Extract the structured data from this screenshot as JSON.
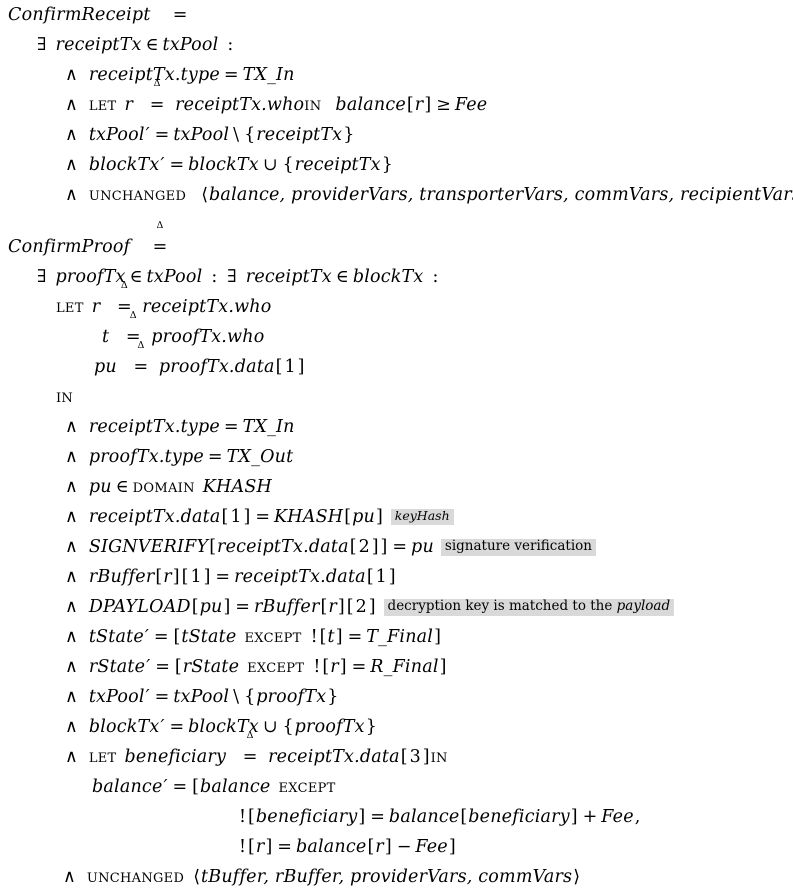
{
  "document": {
    "kind": "tla-plus-specification",
    "operators": [
      {
        "name": "ConfirmReceipt",
        "defined_as": "≜",
        "lines": [
          {
            "id": "cr-exists",
            "text": "∃ receiptTx ∈ txPool :"
          },
          {
            "id": "cr-1",
            "text": "∧ receiptTx.type = TX_In"
          },
          {
            "id": "cr-2",
            "text": "∧ LET r ≜ receiptTx.who IN balance[r] ≥ Fee"
          },
          {
            "id": "cr-3",
            "text": "∧ txPool′ = txPool \\ {receiptTx}"
          },
          {
            "id": "cr-4",
            "text": "∧ blockTx′ = blockTx ∪ {receiptTx}"
          },
          {
            "id": "cr-5",
            "text": "∧ UNCHANGED ⟨balance, providerVars, transporterVars, commVars, recipientVars⟩"
          }
        ]
      },
      {
        "name": "ConfirmProof",
        "defined_as": "≜",
        "lines": [
          {
            "id": "cp-exists",
            "text": "∃ proofTx ∈ txPool : ∃ receiptTx ∈ blockTx :"
          },
          {
            "id": "cp-let-r",
            "text": "LET r ≜ receiptTx.who"
          },
          {
            "id": "cp-let-t",
            "text": "t ≜ proofTx.who"
          },
          {
            "id": "cp-let-pu",
            "text": "pu ≜ proofTx.data[1]"
          },
          {
            "id": "cp-in",
            "text": "IN"
          },
          {
            "id": "cp-1",
            "text": "∧ receiptTx.type = TX_In"
          },
          {
            "id": "cp-2",
            "text": "∧ proofTx.type = TX_Out"
          },
          {
            "id": "cp-3",
            "text": "∧ pu ∈ DOMAIN KHASH"
          },
          {
            "id": "cp-4",
            "text": "∧ receiptTx.data[1] = KHASH[pu]"
          },
          {
            "id": "cp-5",
            "text": "∧ SIGNVERIFY[receiptTx.data[2]] = pu"
          },
          {
            "id": "cp-6",
            "text": "∧ rBuffer[r][1] = receiptTx.data[1]"
          },
          {
            "id": "cp-7",
            "text": "∧ DPAYLOAD[pu] = rBuffer[r][2]"
          },
          {
            "id": "cp-8",
            "text": "∧ tState′ = [tState EXCEPT ![t] = T_Final]"
          },
          {
            "id": "cp-9",
            "text": "∧ rState′ = [rState EXCEPT ![r] = R_Final]"
          },
          {
            "id": "cp-10",
            "text": "∧ txPool′ = txPool \\ {proofTx}"
          },
          {
            "id": "cp-11",
            "text": "∧ blockTx′ = blockTx ∪ {proofTx}"
          },
          {
            "id": "cp-12",
            "text": "∧ LET beneficiary ≜ receiptTx.data[3] IN"
          },
          {
            "id": "cp-13",
            "text": "balance′ = [balance EXCEPT"
          },
          {
            "id": "cp-14",
            "text": "![beneficiary] = balance[beneficiary] + Fee,"
          },
          {
            "id": "cp-15",
            "text": "![r] = balance[r] − Fee]"
          },
          {
            "id": "cp-16",
            "text": "∧ UNCHANGED ⟨tBuffer, rBuffer, providerVars, commVars⟩"
          }
        ]
      }
    ]
  },
  "symbols": {
    "defined_as": "≜",
    "delta": "Δ",
    "equals": "=",
    "exists": "∃",
    "in": "∈",
    "and": "∧",
    "geq": "≥",
    "setminus": "\\",
    "union": "∪",
    "minus": "−",
    "plus": "+",
    "prime": "′",
    "bang": "!",
    "colon": ":",
    "comma": ",",
    "angle_open": "⟨",
    "angle_close": "⟩",
    "brace_open": "{",
    "brace_close": "}",
    "bracket_open": "[",
    "bracket_close": "]"
  },
  "keywords": {
    "let": "LET",
    "in": "IN",
    "except": "EXCEPT",
    "domain": "DOMAIN",
    "unchanged": "UNCHANGED"
  },
  "op1": {
    "name": "ConfirmReceipt",
    "bound_var": "receiptTx",
    "bound_set": "txPool",
    "type_field": "receiptTx.type",
    "type_value": "TX_In",
    "let_var": "r",
    "let_val": "receiptTx.who",
    "balance": "balance",
    "balance_index": "r",
    "fee": "Fee",
    "txpool_prime": "txPool",
    "txpool": "txPool",
    "blocktx_prime": "blockTx",
    "blocktx": "blockTx",
    "unchanged_tuple": "balance, providerVars, transporterVars, commVars, recipientVars"
  },
  "op2": {
    "name": "ConfirmProof",
    "bound_var_1": "proofTx",
    "bound_set_1": "txPool",
    "bound_var_2": "receiptTx",
    "bound_set_2": "blockTx",
    "let_r": "r",
    "let_r_val": "receiptTx.who",
    "let_t": "t",
    "let_t_val": "proofTx.who",
    "let_pu": "pu",
    "let_pu_val_base": "proofTx.data",
    "let_pu_val_index": "1",
    "receipt_type": "receiptTx.type",
    "receipt_type_value": "TX_In",
    "proof_type": "proofTx.type",
    "proof_type_value": "TX_Out",
    "pu": "pu",
    "khash": "KHASH",
    "receipt_data": "receiptTx.data",
    "idx1": "1",
    "idx2": "2",
    "idx3": "3",
    "signverify": "SIGNVERIFY",
    "rbuffer": "rBuffer",
    "r": "r",
    "dpayload": "DPAYLOAD",
    "tstate": "tState",
    "t": "t",
    "t_final": "T_Final",
    "rstate": "rState",
    "r_final": "R_Final",
    "txpool": "txPool",
    "blocktx": "blockTx",
    "proof_tx": "proofTx",
    "beneficiary": "beneficiary",
    "balance": "balance",
    "fee": "Fee",
    "unchanged_tuple": "tBuffer, rBuffer, providerVars, commVars"
  },
  "annotations": [
    {
      "id": "note-keyhash",
      "text": "keyHash",
      "style": "italic",
      "attached_to": "cp-4",
      "background": "#d9d9d9"
    },
    {
      "id": "note-signature",
      "text": "signature verification",
      "style": "roman",
      "attached_to": "cp-5",
      "background": "#d9d9d9"
    },
    {
      "id": "note-decryption",
      "text_before": "decryption key is matched to the ",
      "text_emphasis": "payload",
      "style": "roman-with-italic-tail",
      "attached_to": "cp-7",
      "background": "#d9d9d9"
    }
  ],
  "colors": {
    "background": "#ffffff",
    "text": "#000000",
    "highlight": "#d9d9d9"
  }
}
